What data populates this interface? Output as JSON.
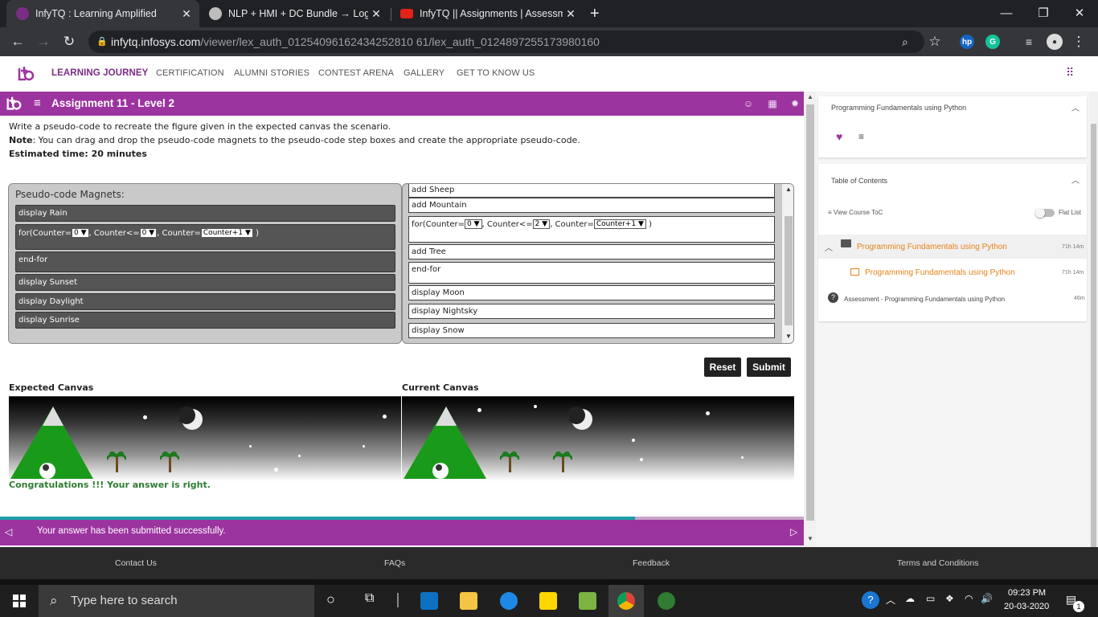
{
  "browser": {
    "tabs": [
      {
        "title": "InfyTQ : Learning Amplified",
        "active": true
      },
      {
        "title": "NLP + HMI + DC Bundle → Logic",
        "active": false
      },
      {
        "title": "InfyTQ || Assignments | Assessme",
        "active": false
      }
    ],
    "new_tab": "+",
    "url_host": "infytq.infosys.com",
    "url_path": "/viewer/lex_auth_01254096162434252810 61/lex_auth_0124897255173980160",
    "window_controls": {
      "minimize": "—",
      "restore": "❐",
      "close": "✕"
    }
  },
  "site": {
    "logo": "tq",
    "nav": [
      "LEARNING JOURNEY",
      "CERTIFICATION",
      "ALUMNI STORIES",
      "CONTEST ARENA",
      "GALLERY",
      "GET TO KNOW US"
    ],
    "accent": "#9c34a0",
    "active_nav": "#7b2d86"
  },
  "assignment": {
    "title": "Assignment 11 - Level 2",
    "instruction": "Write a pseudo-code to recreate the figure given in the expected canvas the scenario.",
    "note_label": "Note",
    "note_text": ": You can drag and drop the pseudo-code magnets to the pseudo-code step boxes and create the appropriate pseudo-code.",
    "estimated_time": "Estimated time: 20 minutes",
    "magnets_label": "Pseudo-code Magnets:",
    "magnets": {
      "m1": "display Rain",
      "for_counter_label": "for(Counter=",
      "for_counter_val": "0",
      "for_cond_label": ", Counter<=",
      "for_cond_val": "0",
      "for_inc_label": ", Counter=",
      "for_inc_val": "Counter+1",
      "for_close": ")",
      "m3": "end-for",
      "m4": "display Sunset",
      "m5": "display Daylight",
      "m6": "display Sunrise"
    },
    "steps": {
      "s1": "add Sheep",
      "s2": "add Mountain",
      "for_counter_label": "for(Counter=",
      "for_counter_val": "0",
      "for_cond_label": ", Counter<=",
      "for_cond_val": "2",
      "for_inc_label": ", Counter=",
      "for_inc_val": "Counter+1",
      "for_close": ")",
      "s4": "add Tree",
      "s5": "end-for",
      "s6": "display Moon",
      "s7": "display Nightsky",
      "s8": "display Snow"
    },
    "reset": "Reset",
    "submit": "Submit",
    "expected_canvas": "Expected Canvas",
    "current_canvas": "Current Canvas",
    "congrats": "Congratulations !!! Your answer is right.",
    "toast": "Your answer has been submitted successfully."
  },
  "footer": [
    "Contact Us",
    "FAQs",
    "Feedback",
    "Terms and Conditions"
  ],
  "right_panel": {
    "course_title": "Programming Fundamentals using Python",
    "toc_title": "Table of Contents",
    "view_toc": "View Course ToC",
    "flat_list": "Flat List",
    "items": [
      {
        "label": "Programming Fundamentals using Python",
        "duration": "71h 14m"
      },
      {
        "label": "Programming Fundamentals using Python",
        "duration": "71h 14m"
      },
      {
        "label": "Assessment - Programming Fundamentals using Python",
        "duration": "46m"
      }
    ]
  },
  "taskbar": {
    "search_placeholder": "Type here to search",
    "time": "09:23 PM",
    "date": "20-03-2020",
    "notifications": "1"
  }
}
